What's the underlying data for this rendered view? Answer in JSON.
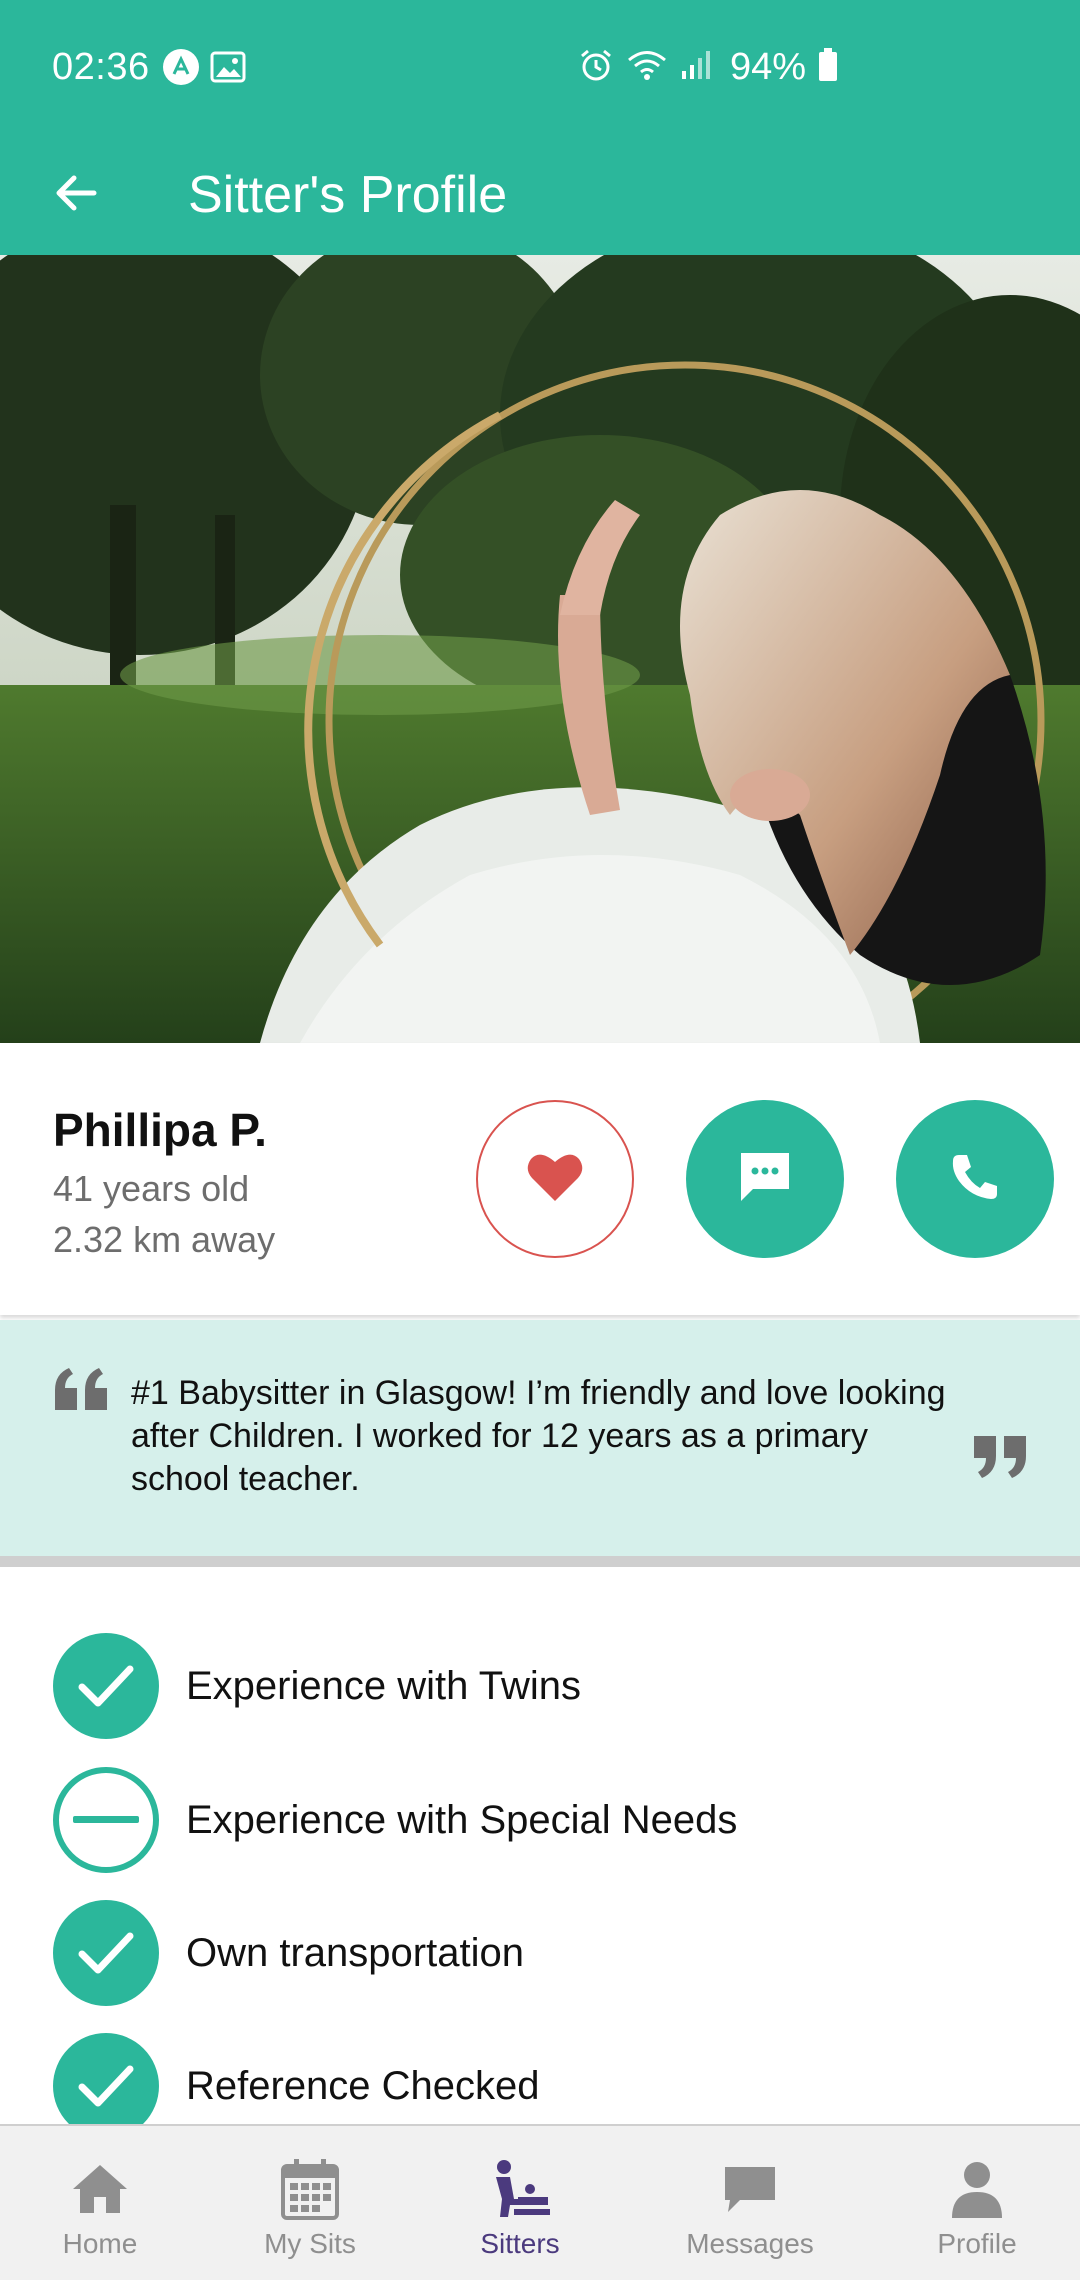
{
  "status_bar": {
    "time": "02:36",
    "battery": "94%",
    "icons": [
      "app-notification-icon",
      "image-icon",
      "alarm-icon",
      "wifi-icon",
      "signal-icon",
      "battery-icon"
    ]
  },
  "app_bar": {
    "title": "Sitter's Profile",
    "back_icon": "arrow-left-icon"
  },
  "sitter": {
    "name": "Phillipa P.",
    "age": "41 years old",
    "distance": "2.32 km away"
  },
  "actions": {
    "favorite_icon": "heart-icon",
    "message_icon": "chat-bubble-icon",
    "call_icon": "phone-icon"
  },
  "quote": {
    "text": "#1 Babysitter in Glasgow! I’m friendly and love looking after Children. I worked for 12 years as a primary school teacher."
  },
  "features": [
    {
      "label": "Experience with Twins",
      "status": "yes"
    },
    {
      "label": "Experience with Special Needs",
      "status": "no"
    },
    {
      "label": "Own transportation",
      "status": "yes"
    },
    {
      "label": "Reference Checked",
      "status": "yes"
    }
  ],
  "bottom_nav": {
    "items": [
      {
        "label": "Home",
        "icon": "home-icon"
      },
      {
        "label": "My Sits",
        "icon": "calendar-icon"
      },
      {
        "label": "Sitters",
        "icon": "sitter-icon",
        "active": true
      },
      {
        "label": "Messages",
        "icon": "messages-icon"
      },
      {
        "label": "Profile",
        "icon": "person-icon"
      }
    ]
  },
  "colors": {
    "primary": "#2bb79b",
    "favorite": "#d9534f",
    "quote_bg": "#d6f0eb",
    "nav_active": "#4b3a7e",
    "nav_inactive": "#8f8f8f"
  }
}
